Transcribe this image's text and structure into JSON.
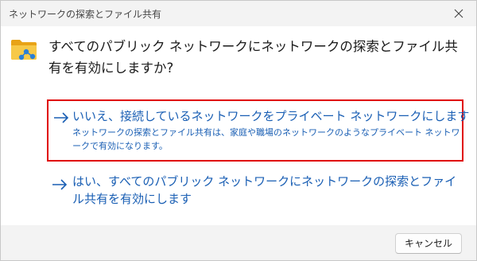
{
  "window": {
    "title": "ネットワークの探索とファイル共有"
  },
  "header": {
    "icon": "network-folder-icon",
    "question": "すべてのパブリック ネットワークにネットワークの探索とファイル共有を有効にしますか?"
  },
  "options": [
    {
      "icon": "arrow-right-icon",
      "title": "いいえ、接続しているネットワークをプライベート ネットワークにします",
      "description": "ネットワークの探索とファイル共有は、家庭や職場のネットワークのようなプライベート ネットワークで有効になります。",
      "highlighted": true
    },
    {
      "icon": "arrow-right-icon",
      "title": "はい、すべてのパブリック ネットワークにネットワークの探索とファイル共有を有効にします"
    }
  ],
  "footer": {
    "cancel_label": "キャンセル"
  },
  "colors": {
    "link": "#1a5fb4",
    "highlight_border": "#e00000",
    "chrome_background": "#f3f3f3"
  }
}
